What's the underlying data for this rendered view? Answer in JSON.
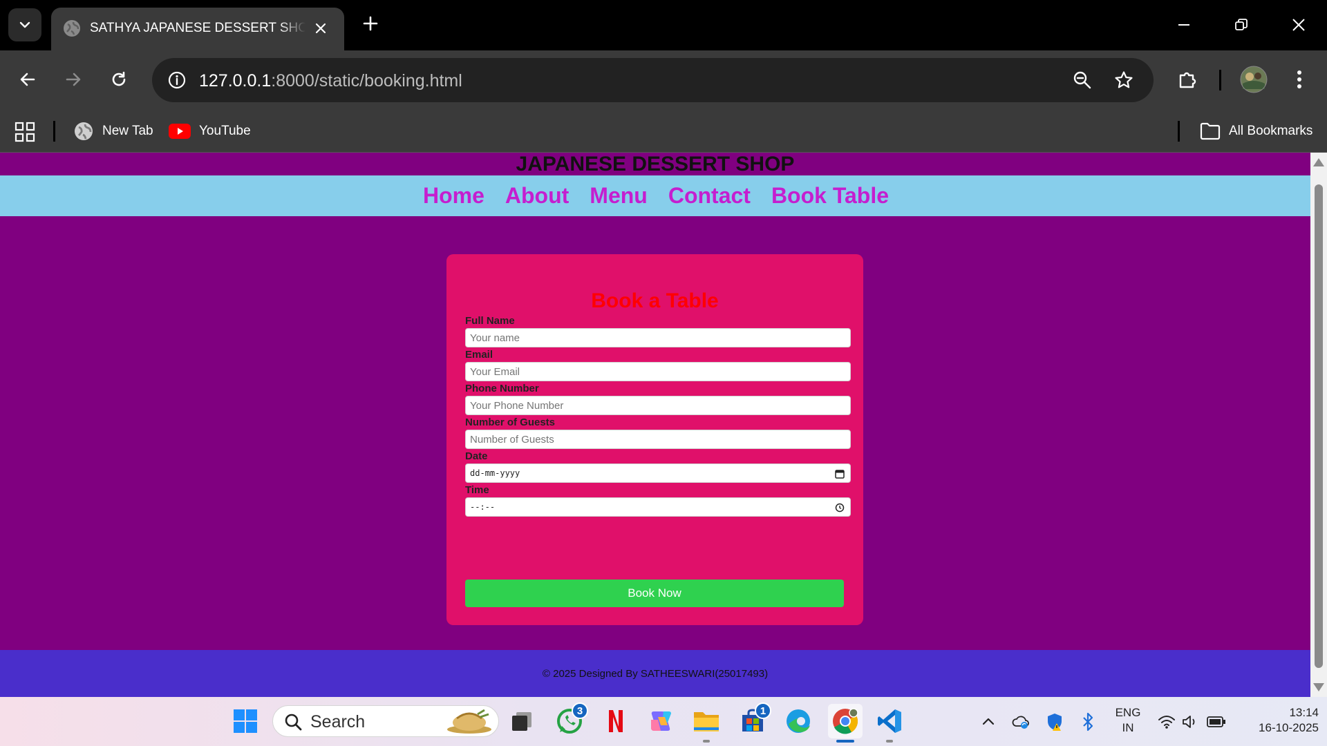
{
  "browser": {
    "tab_title": "SATHYA JAPANESE DESSERT SHOP - Booking",
    "url_host": "127.0.0.1",
    "url_rest": ":8000/static/booking.html",
    "bookmarks": [
      {
        "label": "New Tab",
        "icon": "globe-icon"
      },
      {
        "label": "YouTube",
        "icon": "youtube-icon"
      }
    ],
    "all_bookmarks_label": "All Bookmarks"
  },
  "site": {
    "title": "JAPANESE DESSERT SHOP",
    "nav": [
      "Home",
      "About",
      "Menu",
      "Contact",
      "Book Table"
    ],
    "footer": "© 2025 Designed By SATHEESWARI(25017493)"
  },
  "booking": {
    "heading": "Book a Table",
    "fields": [
      {
        "label": "Full Name",
        "placeholder": "Your name"
      },
      {
        "label": "Email",
        "placeholder": "Your Email"
      },
      {
        "label": "Phone Number",
        "placeholder": "Your Phone Number"
      },
      {
        "label": "Number of Guests",
        "placeholder": "Number of Guests"
      },
      {
        "label": "Date",
        "placeholder": "dd-mm-yyyy"
      },
      {
        "label": "Time",
        "placeholder": "--:--"
      }
    ],
    "submit_label": "Book Now"
  },
  "taskbar": {
    "search_label": "Search",
    "whatsapp_badge": "3",
    "store_badge": "1",
    "lang_line1": "ENG",
    "lang_line2": "IN",
    "time": "13:14",
    "date": "16-10-2025"
  },
  "colors": {
    "page_bg": "#800080",
    "nav_bg": "#87ceeb",
    "nav_link": "#c51ecf",
    "card_bg": "#e0106a",
    "heading": "#ff0000",
    "button": "#2fd14f",
    "footer_bg": "#4a2ecb"
  }
}
